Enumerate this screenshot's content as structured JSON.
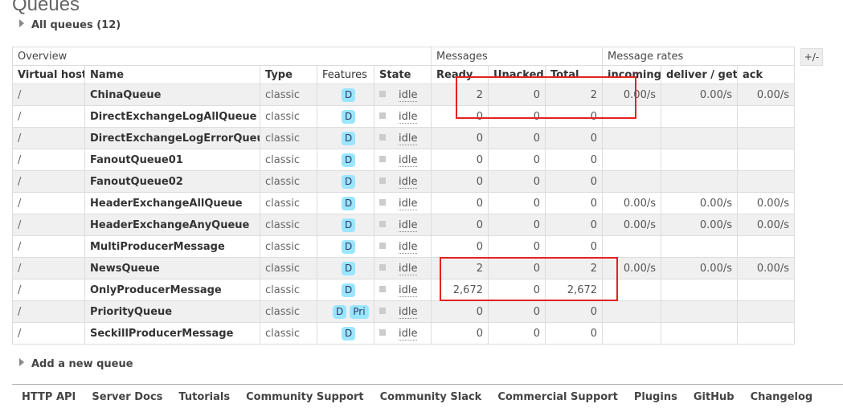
{
  "page_title": "Queues",
  "all_queues_label": "All queues (12)",
  "add_queue_label": "Add a new queue",
  "plus_minus": "+/-",
  "table": {
    "groups": {
      "overview": "Overview",
      "messages": "Messages",
      "rates": "Message rates"
    },
    "columns": [
      "Virtual host",
      "Name",
      "Type",
      "Features",
      "State",
      "Ready",
      "Unacked",
      "Total",
      "incoming",
      "deliver / get",
      "ack"
    ],
    "rows": [
      {
        "vhost": "/",
        "name": "ChinaQueue",
        "type": "classic",
        "features": [
          "D"
        ],
        "state": "idle",
        "ready": "2",
        "unacked": "0",
        "total": "2",
        "incoming": "0.00/s",
        "deliver": "0.00/s",
        "ack": "0.00/s"
      },
      {
        "vhost": "/",
        "name": "DirectExchangeLogAllQueue",
        "type": "classic",
        "features": [
          "D"
        ],
        "state": "idle",
        "ready": "0",
        "unacked": "0",
        "total": "0",
        "incoming": "",
        "deliver": "",
        "ack": ""
      },
      {
        "vhost": "/",
        "name": "DirectExchangeLogErrorQueue",
        "type": "classic",
        "features": [
          "D"
        ],
        "state": "idle",
        "ready": "0",
        "unacked": "0",
        "total": "0",
        "incoming": "",
        "deliver": "",
        "ack": ""
      },
      {
        "vhost": "/",
        "name": "FanoutQueue01",
        "type": "classic",
        "features": [
          "D"
        ],
        "state": "idle",
        "ready": "0",
        "unacked": "0",
        "total": "0",
        "incoming": "",
        "deliver": "",
        "ack": ""
      },
      {
        "vhost": "/",
        "name": "FanoutQueue02",
        "type": "classic",
        "features": [
          "D"
        ],
        "state": "idle",
        "ready": "0",
        "unacked": "0",
        "total": "0",
        "incoming": "",
        "deliver": "",
        "ack": ""
      },
      {
        "vhost": "/",
        "name": "HeaderExchangeAllQueue",
        "type": "classic",
        "features": [
          "D"
        ],
        "state": "idle",
        "ready": "0",
        "unacked": "0",
        "total": "0",
        "incoming": "0.00/s",
        "deliver": "0.00/s",
        "ack": "0.00/s"
      },
      {
        "vhost": "/",
        "name": "HeaderExchangeAnyQueue",
        "type": "classic",
        "features": [
          "D"
        ],
        "state": "idle",
        "ready": "0",
        "unacked": "0",
        "total": "0",
        "incoming": "0.00/s",
        "deliver": "0.00/s",
        "ack": "0.00/s"
      },
      {
        "vhost": "/",
        "name": "MultiProducerMessage",
        "type": "classic",
        "features": [
          "D"
        ],
        "state": "idle",
        "ready": "0",
        "unacked": "0",
        "total": "0",
        "incoming": "",
        "deliver": "",
        "ack": ""
      },
      {
        "vhost": "/",
        "name": "NewsQueue",
        "type": "classic",
        "features": [
          "D"
        ],
        "state": "idle",
        "ready": "2",
        "unacked": "0",
        "total": "2",
        "incoming": "0.00/s",
        "deliver": "0.00/s",
        "ack": "0.00/s"
      },
      {
        "vhost": "/",
        "name": "OnlyProducerMessage",
        "type": "classic",
        "features": [
          "D"
        ],
        "state": "idle",
        "ready": "2,672",
        "unacked": "0",
        "total": "2,672",
        "incoming": "",
        "deliver": "",
        "ack": ""
      },
      {
        "vhost": "/",
        "name": "PriorityQueue",
        "type": "classic",
        "features": [
          "D",
          "Pri"
        ],
        "state": "idle",
        "ready": "0",
        "unacked": "0",
        "total": "0",
        "incoming": "",
        "deliver": "",
        "ack": ""
      },
      {
        "vhost": "/",
        "name": "SeckillProducerMessage",
        "type": "classic",
        "features": [
          "D"
        ],
        "state": "idle",
        "ready": "0",
        "unacked": "0",
        "total": "0",
        "incoming": "",
        "deliver": "",
        "ack": ""
      }
    ]
  },
  "footer": {
    "links": [
      "HTTP API",
      "Server Docs",
      "Tutorials",
      "Community Support",
      "Community Slack",
      "Commercial Support",
      "Plugins",
      "GitHub",
      "Changelog"
    ]
  },
  "colors": {
    "highlight": "#e32222",
    "feature_badge": "#99e6ff",
    "row_alt": "#f0f0f0"
  },
  "icons": {
    "section_toggle": "triangle-right-icon"
  }
}
